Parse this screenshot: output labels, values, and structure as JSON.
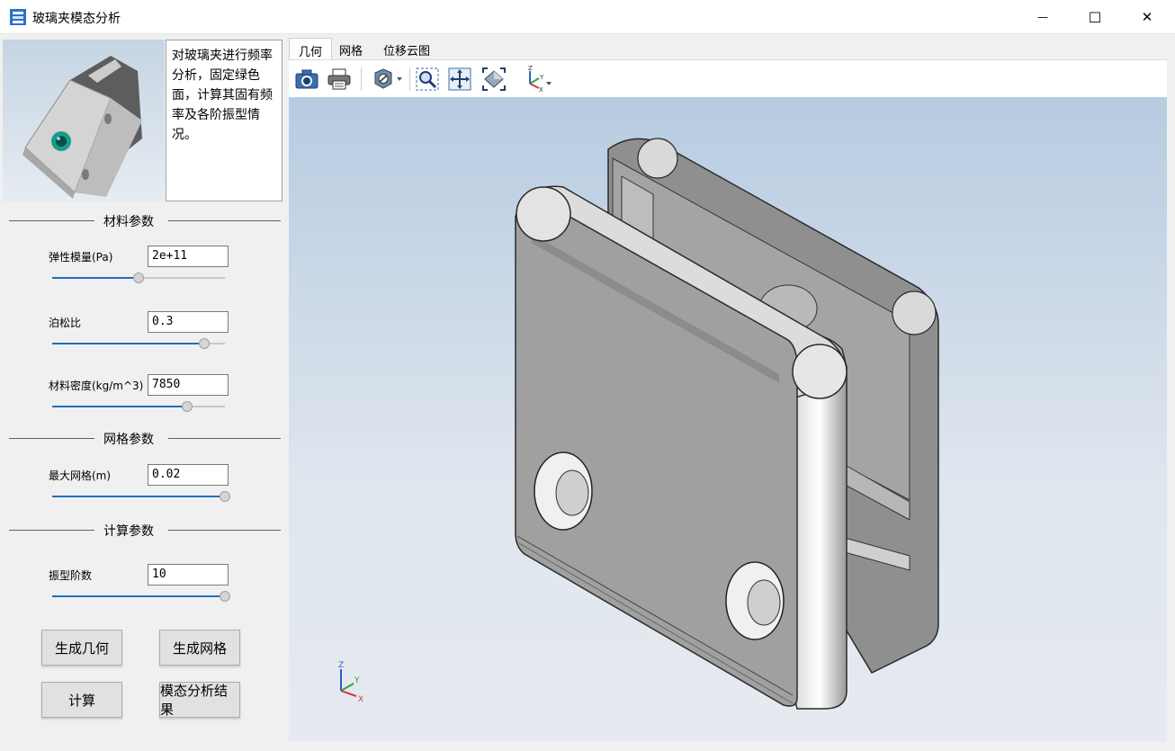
{
  "window": {
    "title": "玻璃夹模态分析",
    "minimize_symbol": "—",
    "maximize_symbol": "☐",
    "close_symbol": "✕"
  },
  "description": "对玻璃夹进行频率分析，固定绿色面，计算其固有频率及各阶振型情况。",
  "sections": {
    "material": "材料参数",
    "mesh": "网格参数",
    "compute": "计算参数"
  },
  "params": {
    "youngs_modulus": {
      "label": "弹性模量(Pa)",
      "value": "2e+11",
      "slider_fraction": 0.5
    },
    "poisson": {
      "label": "泊松比",
      "value": "0.3",
      "slider_fraction": 0.88
    },
    "density": {
      "label": "材料密度(kg/m^3)",
      "value": "7850",
      "slider_fraction": 0.78
    },
    "max_mesh": {
      "label": "最大网格(m)",
      "value": "0.02",
      "slider_fraction": 1.0
    },
    "mode_count": {
      "label": "振型阶数",
      "value": "10",
      "slider_fraction": 1.0
    }
  },
  "buttons": {
    "gen_geometry": "生成几何",
    "gen_mesh": "生成网格",
    "compute": "计算",
    "modal_results": "模态分析结果"
  },
  "tabs": [
    {
      "label": "几何",
      "active": true
    },
    {
      "label": "网格",
      "active": false
    },
    {
      "label": "位移云图",
      "active": false
    }
  ],
  "toolbar_icons": [
    "camera-icon",
    "print-icon",
    "section-icon",
    "zoom-region-icon",
    "fit-all-icon",
    "view-fit-icon",
    "axes-icon"
  ],
  "colors": {
    "accent": "#1e6fc0",
    "model_green": "#1c9a8a"
  },
  "triad": {
    "x": "X",
    "y": "Y",
    "z": "Z"
  }
}
